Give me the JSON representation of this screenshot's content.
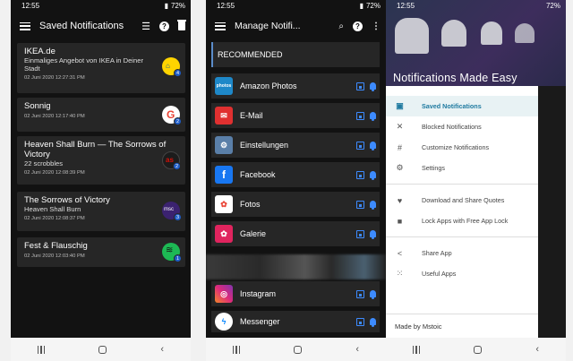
{
  "status": {
    "time": "12:55",
    "battery": "72%"
  },
  "screen1": {
    "title": "Saved Notifications",
    "cards": [
      {
        "title": "IKEA.de",
        "body": "Einmaliges Angebot von IKEA in Deiner Stadt",
        "time": "02 Juni 2020 12:27:31 PM",
        "badge": "4",
        "color": "#0058a3"
      },
      {
        "title": "Sonnig",
        "body": "",
        "time": "02 Juni 2020 12:17:40 PM",
        "badge": "2",
        "color": "#ffffff"
      },
      {
        "title": "Heaven Shall Burn — The Sorrows of Victory",
        "body": "22 scrobbles",
        "time": "02 Juni 2020 12:08:39 PM",
        "badge": "2",
        "color": "#2a2a2a"
      },
      {
        "title": "The Sorrows of Victory",
        "body": "Heaven Shall Burn",
        "time": "02 Juni 2020 12:08:37 PM",
        "badge": "3",
        "color": "#3b2270"
      },
      {
        "title": "Fest & Flauschig",
        "body": "",
        "time": "02 Juni 2020 12:03:40 PM",
        "badge": "1",
        "color": "#1db954"
      }
    ]
  },
  "screen2": {
    "title": "Manage Notifi...",
    "section": "RECOMMENDED",
    "apps": [
      {
        "name": "Amazon Photos",
        "color": "#1e88c8",
        "glyph": "photos"
      },
      {
        "name": "E-Mail",
        "color": "#e03030",
        "glyph": "✉"
      },
      {
        "name": "Einstellungen",
        "color": "#5a7fa8",
        "glyph": "⚙"
      },
      {
        "name": "Facebook",
        "color": "#1877f2",
        "glyph": "f"
      },
      {
        "name": "Fotos",
        "color": "#ffffff",
        "glyph": "✿"
      },
      {
        "name": "Galerie",
        "color": "#e0245e",
        "glyph": "✿"
      },
      {
        "name": "Instagram",
        "color": "#c13584",
        "glyph": "◎"
      },
      {
        "name": "Messenger",
        "color": "#0084ff",
        "glyph": "ϟ"
      }
    ]
  },
  "screen3": {
    "hero_title": "Notifications Made Easy",
    "items": [
      {
        "label": "Saved Notifications",
        "icon": "save-icon",
        "glyph": "▣",
        "active": true
      },
      {
        "label": "Blocked Notifications",
        "icon": "bell-off-icon",
        "glyph": "🔕",
        "active": false
      },
      {
        "label": "Customize Notifications",
        "icon": "hashtag-icon",
        "glyph": "#",
        "active": false
      },
      {
        "label": "Settings",
        "icon": "gear-icon",
        "glyph": "⚙",
        "active": false
      },
      {
        "label": "Download and Share Quotes",
        "icon": "heart-icon",
        "glyph": "♥",
        "active": false
      },
      {
        "label": "Lock Apps with Free App Lock",
        "icon": "lock-icon",
        "glyph": "🔒",
        "active": false
      },
      {
        "label": "Share App",
        "icon": "share-icon",
        "glyph": "<",
        "active": false
      },
      {
        "label": "Useful Apps",
        "icon": "apps-grid-icon",
        "glyph": "⋮⋮",
        "active": false
      }
    ],
    "footer": "Made by Mstoic"
  }
}
